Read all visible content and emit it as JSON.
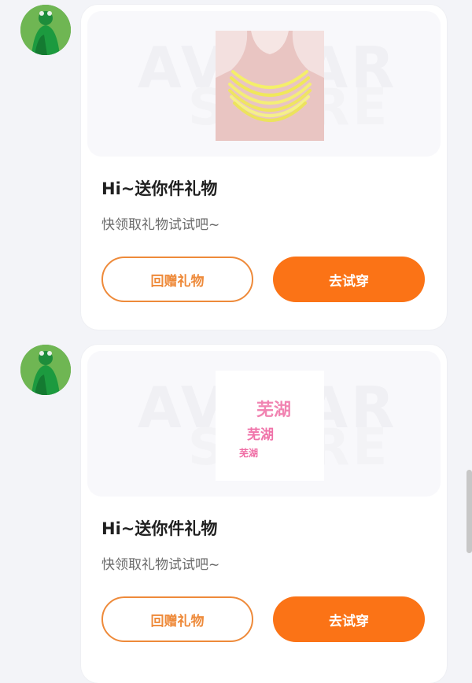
{
  "messages": [
    {
      "title": "Hi~送你件礼物",
      "subtitle": "快领取礼物试试吧~",
      "return_button": "回赠礼物",
      "try_button": "去试穿",
      "watermark_top": "AVATAR",
      "watermark_bottom": "STORE",
      "image_icon": "necklace-icon"
    },
    {
      "title": "Hi~送你件礼物",
      "subtitle": "快领取礼物试试吧~",
      "return_button": "回赠礼物",
      "try_button": "去试穿",
      "watermark_top": "AVATAR",
      "watermark_bottom": "STORE",
      "image_icon": "text-image",
      "image_texts": [
        "芜湖",
        "芜湖",
        "芜湖"
      ]
    }
  ],
  "colors": {
    "accent": "#fb7316",
    "outline": "#ee8a3a",
    "page_bg": "#f3f4f8"
  }
}
